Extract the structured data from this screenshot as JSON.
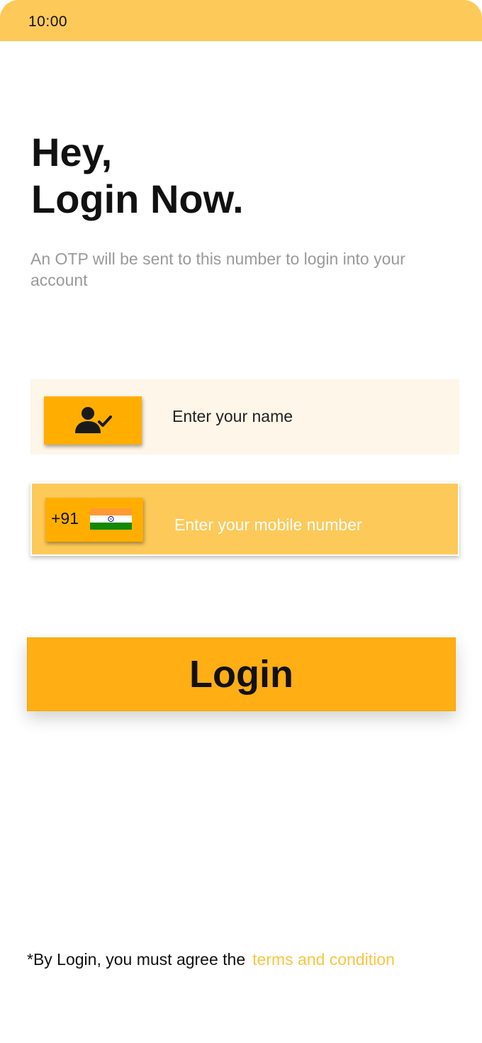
{
  "status_bar": {
    "time": "10:00"
  },
  "heading": {
    "line1": "Hey,",
    "line2": "Login Now."
  },
  "subtitle": "An OTP will be sent to this number to login into your account",
  "name_field": {
    "icon": "user-check-icon",
    "placeholder": "Enter your name",
    "value": ""
  },
  "mobile_field": {
    "country_code": "+91",
    "flag_icon": "india-flag-icon",
    "placeholder": "Enter your mobile number",
    "value": ""
  },
  "login_button": {
    "label": "Login"
  },
  "terms": {
    "prefix": "*By Login, you must agree the",
    "link_text": "terms and condition"
  },
  "colors": {
    "accent": "#FFAE00",
    "status_bar": "#FDC959",
    "name_field_bg": "#FEF6E8",
    "mobile_field_bg": "#FDC959",
    "button": "#FFAE13",
    "link": "#F9C542",
    "subtitle_text": "#9A9A9A"
  }
}
